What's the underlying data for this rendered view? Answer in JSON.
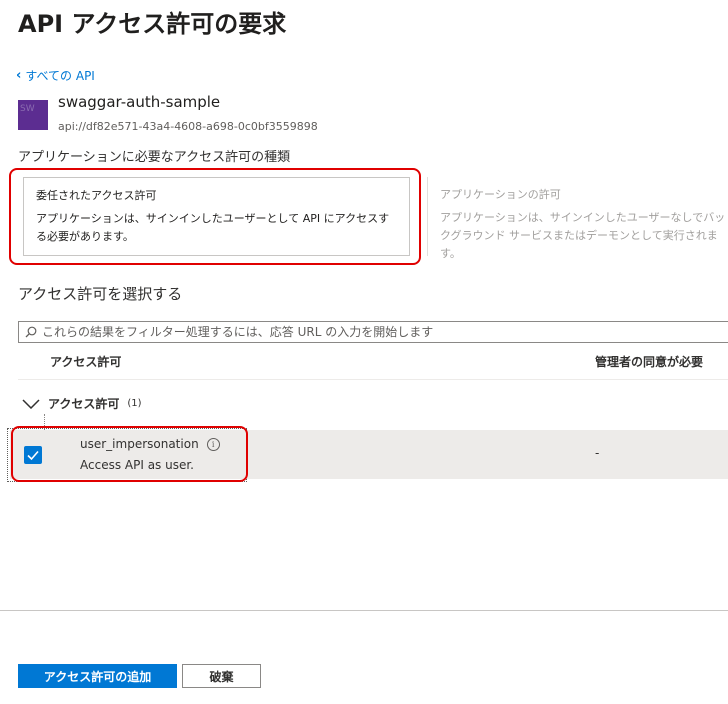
{
  "page": {
    "title": "API アクセス許可の要求",
    "back_link": "すべての API"
  },
  "api": {
    "logo_text": "SW",
    "name": "swaggar-auth-sample",
    "id": "api://df82e571-43a4-4608-a698-0c0bf3559898"
  },
  "permission_type": {
    "label": "アプリケーションに必要なアクセス許可の種類",
    "delegated": {
      "title": "委任されたアクセス許可",
      "description": "アプリケーションは、サインインしたユーザーとして API にアクセスする必要があります。",
      "selected": true
    },
    "application": {
      "title": "アプリケーションの許可",
      "description": "アプリケーションは、サインインしたユーザーなしでバックグラウンド サービスまたはデーモンとして実行されます。",
      "selected": false
    }
  },
  "select_permissions": {
    "heading": "アクセス許可を選択する",
    "search_placeholder": "これらの結果をフィルター処理するには、応答 URL の入力を開始します",
    "columns": {
      "permission": "アクセス許可",
      "admin_consent": "管理者の同意が必要"
    },
    "group": {
      "label": "アクセス許可",
      "count": "(1)"
    },
    "items": [
      {
        "name": "user_impersonation",
        "description": "Access API as user.",
        "admin_consent": "-",
        "checked": true
      }
    ]
  },
  "footer": {
    "add_button": "アクセス許可の追加",
    "discard_button": "破棄"
  },
  "colors": {
    "accent": "#0078d4",
    "highlight": "#e00000",
    "api_logo": "#5c2d91"
  }
}
